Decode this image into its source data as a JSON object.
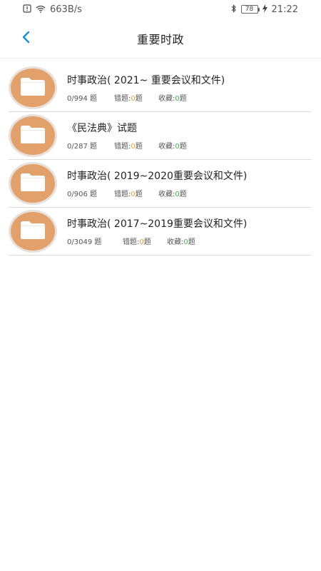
{
  "status_bar": {
    "network_speed": "663B/s",
    "battery_level": "78",
    "time": "21:22",
    "icons": [
      "alert-icon",
      "wifi-icon",
      "bluetooth-icon",
      "battery-icon",
      "charging-icon"
    ]
  },
  "header": {
    "title": "重要时政",
    "back_icon": "chevron-left-icon"
  },
  "colors": {
    "accent": "#1a8fd6",
    "folder": "#e2a06a",
    "wrong_count": "#e8a23c",
    "fav_count": "#4caf50"
  },
  "items": [
    {
      "title": "时事政治( 2021~  重要会议和文件)",
      "progress": "0/994 题",
      "wrong_label": "错题:",
      "wrong_count": "0",
      "wrong_unit": "题",
      "fav_label": "收藏:",
      "fav_count": "0",
      "fav_unit": "题"
    },
    {
      "title": "《民法典》试题",
      "progress": "0/287 题",
      "wrong_label": "错题:",
      "wrong_count": "0",
      "wrong_unit": "题",
      "fav_label": "收藏:",
      "fav_count": "0",
      "fav_unit": "题"
    },
    {
      "title": "时事政治( 2019~2020重要会议和文件)",
      "progress": "0/906 题",
      "wrong_label": "错题:",
      "wrong_count": "0",
      "wrong_unit": "题",
      "fav_label": "收藏:",
      "fav_count": "0",
      "fav_unit": "题"
    },
    {
      "title": "时事政治( 2017~2019重要会议和文件)",
      "progress": "0/3049 题",
      "wrong_label": "错题:",
      "wrong_count": "0",
      "wrong_unit": "题",
      "fav_label": "收藏:",
      "fav_count": "0",
      "fav_unit": "题"
    }
  ]
}
